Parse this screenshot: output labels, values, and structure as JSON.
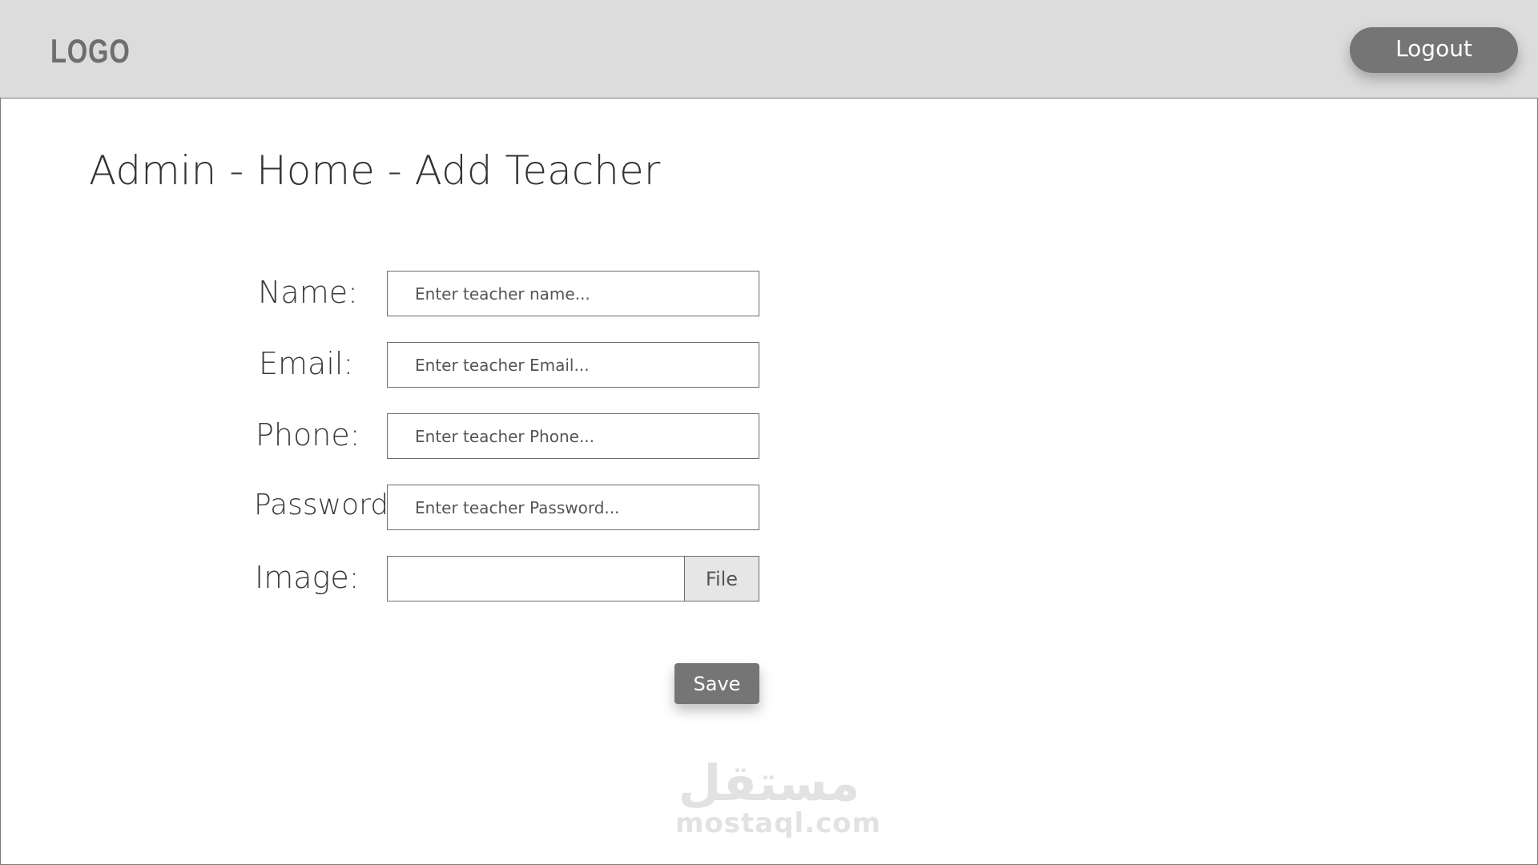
{
  "header": {
    "logo": "LOGO",
    "logout_label": "Logout"
  },
  "page": {
    "title": "Admin - Home - Add Teacher"
  },
  "form": {
    "name_label": "Name:",
    "name_placeholder": "Enter teacher name...",
    "email_label": "Email:",
    "email_placeholder": "Enter teacher Email...",
    "phone_label": "Phone:",
    "phone_placeholder": "Enter teacher Phone...",
    "password_label": "Password:",
    "password_placeholder": "Enter teacher Password...",
    "image_label": "Image:",
    "file_button_label": "File",
    "save_label": "Save"
  },
  "watermark": {
    "arabic": "مستقل",
    "latin": "mostaql.com"
  },
  "colors": {
    "header_bg": "#dcdcdc",
    "button_bg": "#757575",
    "logo_color": "#6e6e6e"
  }
}
